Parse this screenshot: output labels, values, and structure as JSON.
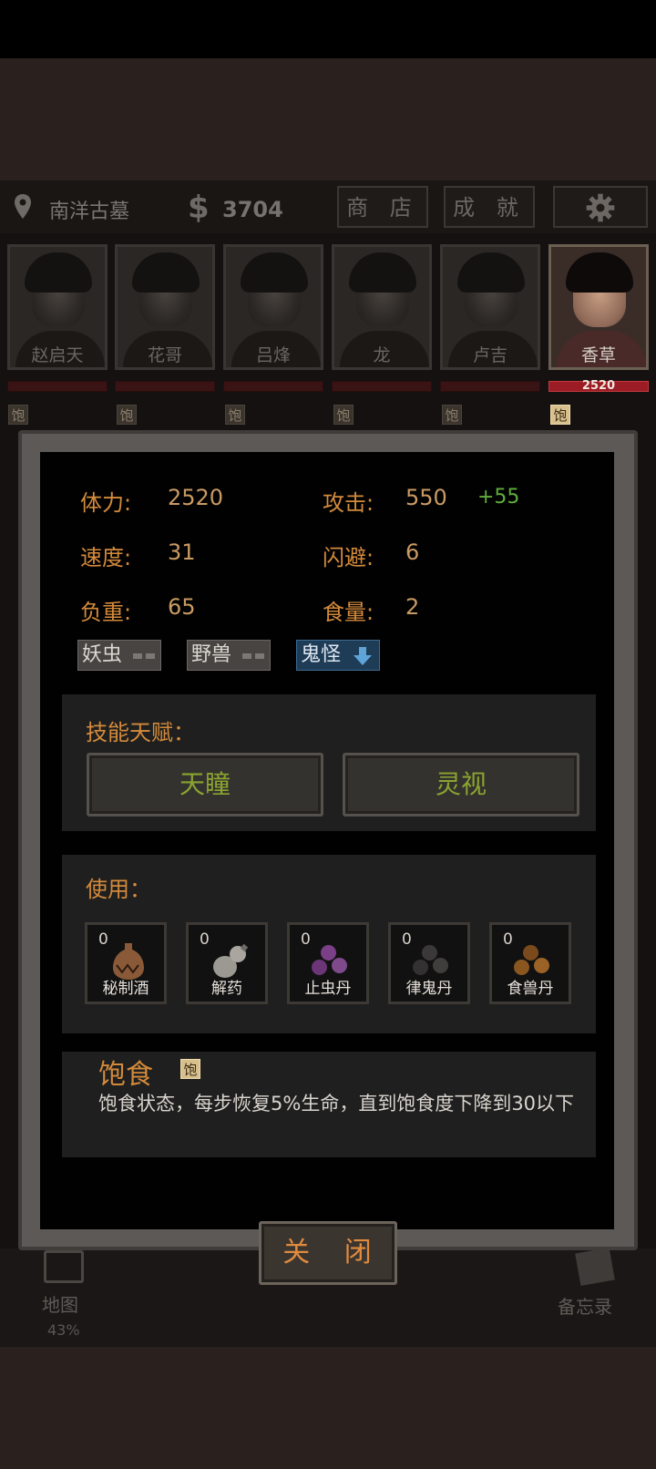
{
  "header": {
    "location": "南洋古墓",
    "money_symbol": "$",
    "money": "3704",
    "shop_button": "商 店",
    "achievement_button": "成 就"
  },
  "characters": [
    {
      "name": "赵启天",
      "full_label": "饱",
      "active": false
    },
    {
      "name": "花哥",
      "full_label": "饱",
      "active": false
    },
    {
      "name": "吕烽",
      "full_label": "饱",
      "active": false
    },
    {
      "name": "龙",
      "full_label": "饱",
      "active": false
    },
    {
      "name": "卢吉",
      "full_label": "饱",
      "active": false
    },
    {
      "name": "香草",
      "full_label": "饱",
      "active": true,
      "hp": "2520"
    }
  ],
  "bottom_nav": {
    "map_label": "地图",
    "map_percent": "43%",
    "memo_label": "备忘录"
  },
  "stats": {
    "hp_label": "体力:",
    "hp_value": "2520",
    "attack_label": "攻击:",
    "attack_value": "550",
    "attack_bonus": "+55",
    "speed_label": "速度:",
    "speed_value": "31",
    "dodge_label": "闪避:",
    "dodge_value": "6",
    "load_label": "负重:",
    "load_value": "65",
    "food_label": "食量:",
    "food_value": "2"
  },
  "affinities": [
    {
      "label": "妖虫",
      "state": "neutral"
    },
    {
      "label": "野兽",
      "state": "neutral"
    },
    {
      "label": "鬼怪",
      "state": "down"
    }
  ],
  "skills": {
    "title": "技能天赋：",
    "items": [
      "天瞳",
      "灵视"
    ]
  },
  "use": {
    "title": "使用：",
    "items": [
      {
        "count": "0",
        "name": "秘制酒"
      },
      {
        "count": "0",
        "name": "解药"
      },
      {
        "count": "0",
        "name": "止虫丹"
      },
      {
        "count": "0",
        "name": "律鬼丹"
      },
      {
        "count": "0",
        "name": "食兽丹"
      }
    ]
  },
  "status_effect": {
    "title": "饱食",
    "badge": "饱",
    "description": "饱食状态，每步恢复5%生命，直到饱食度下降到30以下"
  },
  "close_button": "关 闭",
  "colors": {
    "accent_orange": "#d38a3b",
    "skill_green": "#8aa430",
    "bonus_green": "#5fae3b",
    "hp_red": "#9b1c24"
  }
}
